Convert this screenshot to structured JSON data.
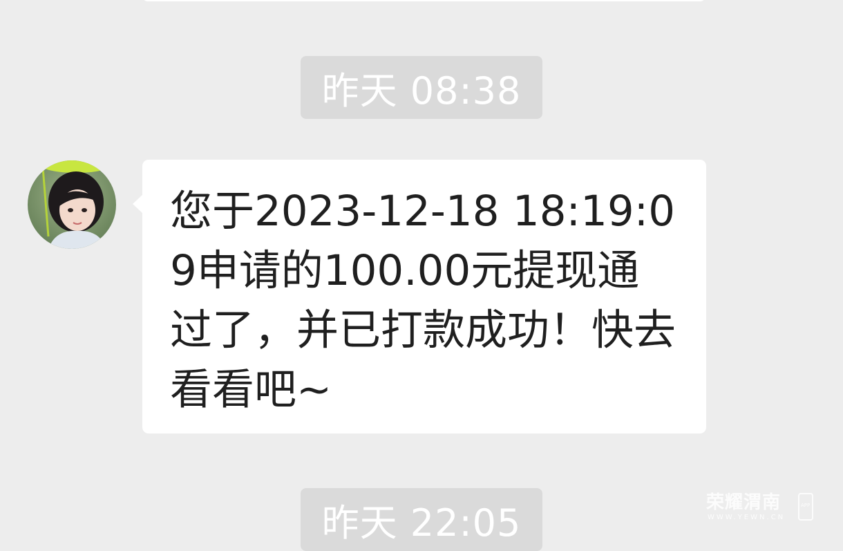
{
  "chat": {
    "timestamps": [
      "昨天 08:38",
      "昨天 22:05"
    ],
    "message": {
      "sender": "incoming",
      "avatar_icon": "girl-avatar-icon",
      "text": "您于2023-12-18 18:19:09申请的100.00元提现通过了，并已打款成功！快去看看吧~"
    }
  },
  "watermark": {
    "title": "荣耀渭南",
    "url": "WWW.YEWN.CN",
    "app_label": "APP"
  },
  "colors": {
    "background": "#ededed",
    "bubble": "#ffffff",
    "timestamp_pill": "#dadada",
    "text": "#1f1f1f"
  }
}
